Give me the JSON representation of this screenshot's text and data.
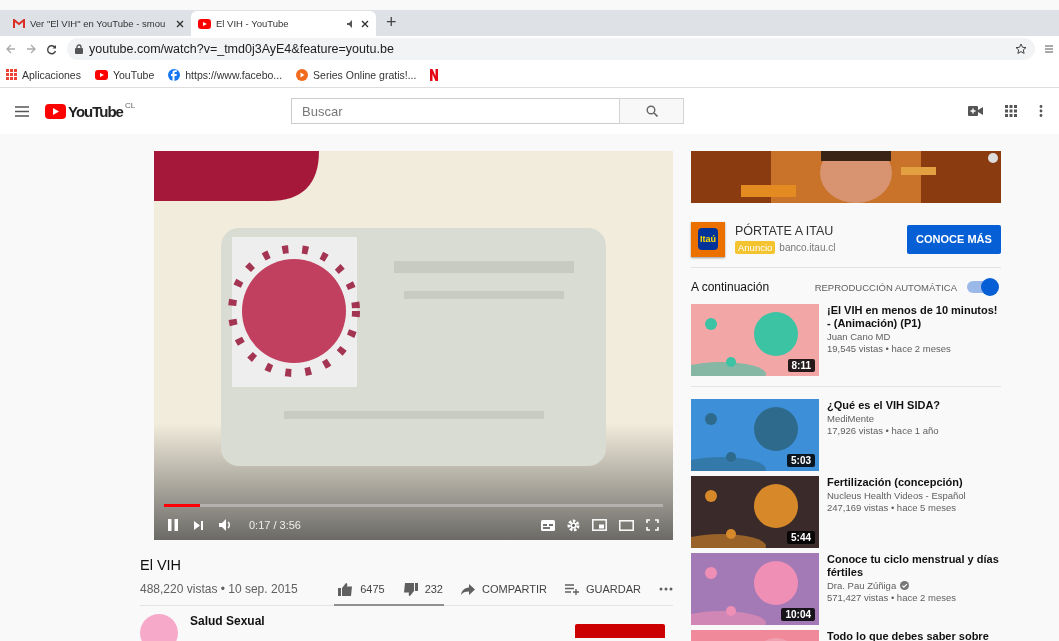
{
  "browser": {
    "tabs": [
      {
        "title": "Ver \"El VIH\" en YouTube - smou",
        "selected": false
      },
      {
        "title": "El VIH - YouTube",
        "selected": true
      }
    ],
    "new_tab": "+",
    "url": "youtube.com/watch?v=_tmd0j3AyE4&feature=youtu.be",
    "bookmarks": [
      "Aplicaciones",
      "YouTube",
      "https://www.facebo...",
      "Series Online gratis!..."
    ]
  },
  "header": {
    "logo_text": "YouTube",
    "country": "CL",
    "search": {
      "placeholder": "Buscar"
    }
  },
  "player": {
    "playing": true,
    "progress": {
      "level": 0.072
    },
    "time": "0:17 / 3:56"
  },
  "video": {
    "title": "El VIH",
    "meta": "488,220 vistas • 10 sep. 2015",
    "likes": "6475",
    "dislikes": "232",
    "share": "COMPARTIR",
    "save": "GUARDAR",
    "channel": "Salud Sexual"
  },
  "ad": {
    "logo": "Itaú",
    "headline": "PÓRTATE A ITAU",
    "badge": "Anuncio",
    "domain": "banco.itau.cl",
    "button": "CONOCE MÁS"
  },
  "up_next": {
    "heading": "A continuación",
    "autoplay": {
      "label": "REPRODUCCIÓN AUTOMÁTICA",
      "on": true
    }
  },
  "videos": [
    {
      "title": "¡El VIH en menos de 10 minutos! - (Animación) (P1)",
      "channel": "Juan Cano MD",
      "verified": false,
      "meta": "19,545 vistas • hace 2 meses",
      "duration": "8:11"
    },
    {
      "title": "¿Qué es el VIH SIDA?",
      "channel": "MediMente",
      "verified": false,
      "meta": "17,926 vistas • hace 1 año",
      "duration": "5:03"
    },
    {
      "title": "Fertilización (concepción)",
      "channel": "Nucleus Health Videos - Español",
      "verified": false,
      "meta": "247,169 vistas • hace 5 meses",
      "duration": "5:44"
    },
    {
      "title": "Conoce tu ciclo menstrual y días fértiles",
      "channel": "Dra. Pau Zúñiga",
      "verified": true,
      "meta": "571,427 vistas • hace 2 meses",
      "duration": "10:04"
    },
    {
      "title": "Todo lo que debes saber sobre"
    }
  ]
}
